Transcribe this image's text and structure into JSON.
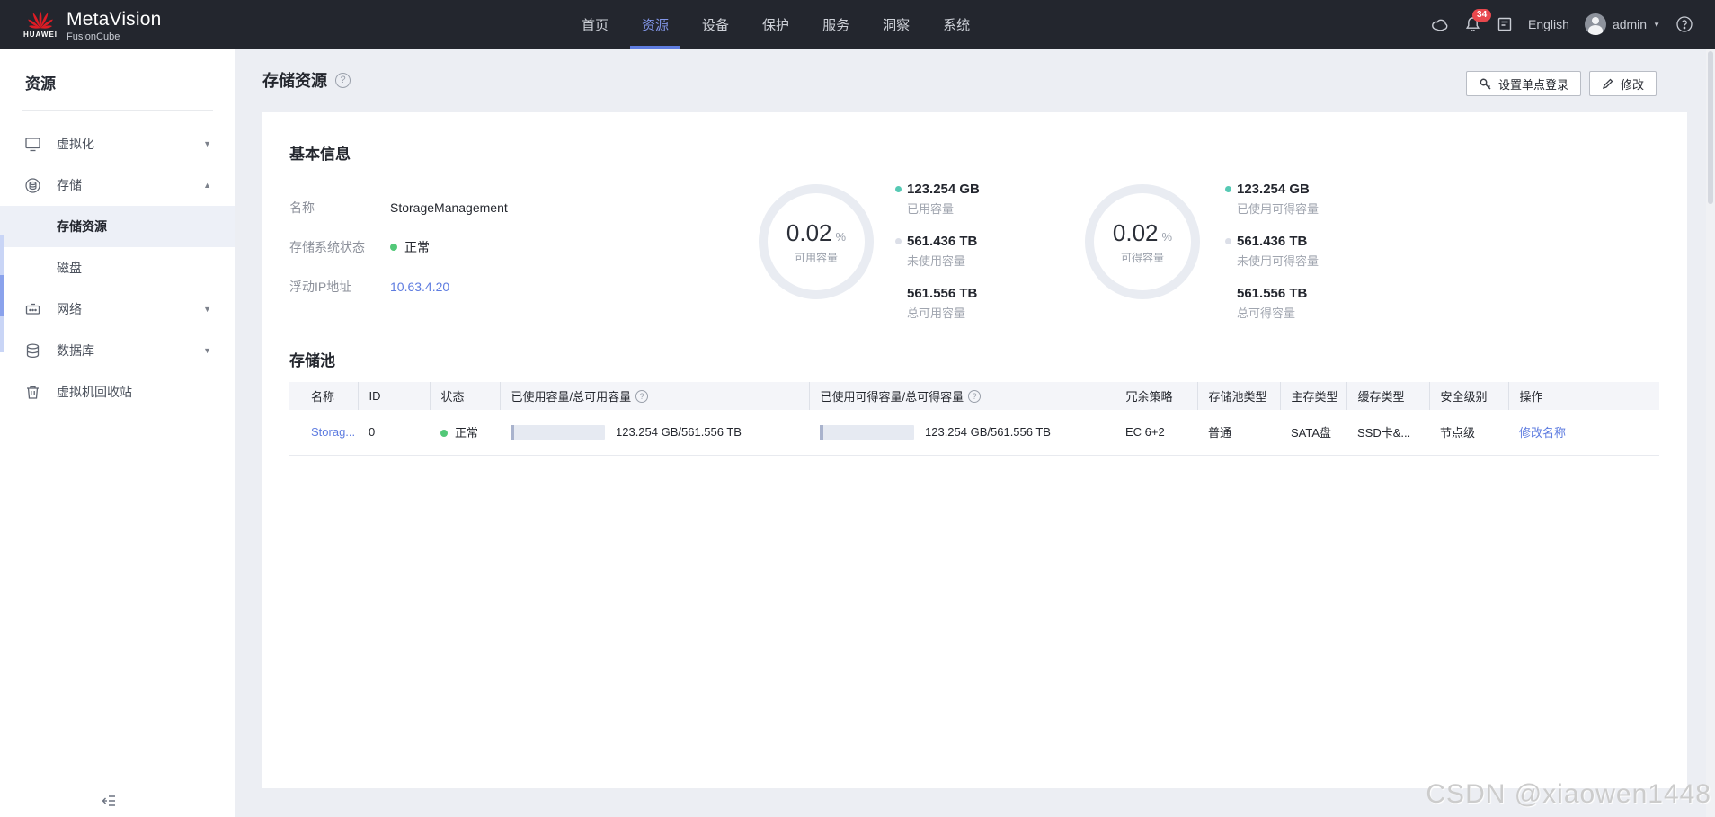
{
  "brand": {
    "logo_word": "HUAWEI",
    "product": "MetaVision",
    "subproduct": "FusionCube"
  },
  "topnav": {
    "items": [
      {
        "label": "首页"
      },
      {
        "label": "资源"
      },
      {
        "label": "设备"
      },
      {
        "label": "保护"
      },
      {
        "label": "服务"
      },
      {
        "label": "洞察"
      },
      {
        "label": "系统"
      }
    ],
    "active_label": "资源"
  },
  "header_right": {
    "notification_count": "34",
    "language": "English",
    "username": "admin"
  },
  "sidebar": {
    "title": "资源",
    "virtualization": "虚拟化",
    "storage": "存储",
    "storage_resource": "存储资源",
    "disk": "磁盘",
    "network": "网络",
    "database": "数据库",
    "vm_recycle_bin": "虚拟机回收站"
  },
  "page": {
    "title": "存储资源",
    "sso_button": "设置单点登录",
    "modify_button": "修改"
  },
  "basic_info": {
    "heading": "基本信息",
    "name_label": "名称",
    "name_value": "StorageManagement",
    "status_label": "存储系统状态",
    "status_value": "正常",
    "ip_label": "浮动IP地址",
    "ip_value": "10.63.4.20"
  },
  "gauges": [
    {
      "percent": "0.02",
      "unit": "%",
      "label": "可用容量",
      "legend": [
        {
          "value": "123.254 GB",
          "label": "已用容量"
        },
        {
          "value": "561.436 TB",
          "label": "未使用容量"
        },
        {
          "value": "561.556 TB",
          "label": "总可用容量"
        }
      ]
    },
    {
      "percent": "0.02",
      "unit": "%",
      "label": "可得容量",
      "legend": [
        {
          "value": "123.254 GB",
          "label": "已使用可得容量"
        },
        {
          "value": "561.436 TB",
          "label": "未使用可得容量"
        },
        {
          "value": "561.556 TB",
          "label": "总可得容量"
        }
      ]
    }
  ],
  "pool": {
    "heading": "存储池",
    "columns": [
      "名称",
      "ID",
      "状态",
      "已使用容量/总可用容量",
      "已使用可得容量/总可得容量",
      "冗余策略",
      "存储池类型",
      "主存类型",
      "缓存类型",
      "安全级别",
      "操作"
    ],
    "row": {
      "name": "Storag...",
      "id": "0",
      "status": "正常",
      "used_capacity": "123.254 GB/561.556 TB",
      "usable_capacity": "123.254 GB/561.556 TB",
      "redundancy": "EC 6+2",
      "pool_type": "普通",
      "primary_storage": "SATA盘",
      "cache_type": "SSD卡&...",
      "security_level": "节点级",
      "action": "修改名称"
    }
  },
  "watermark": "CSDN @xiaowen1448",
  "colors": {
    "accent": "#5e7ce0",
    "nav_active": "#8296e8",
    "link": "#5e7ce0",
    "status_green": "#52c878",
    "legend_used": "#56c9b4",
    "legend_free": "#dcdfe8",
    "badge_red": "#e8484d",
    "header_bg": "#23262e"
  }
}
